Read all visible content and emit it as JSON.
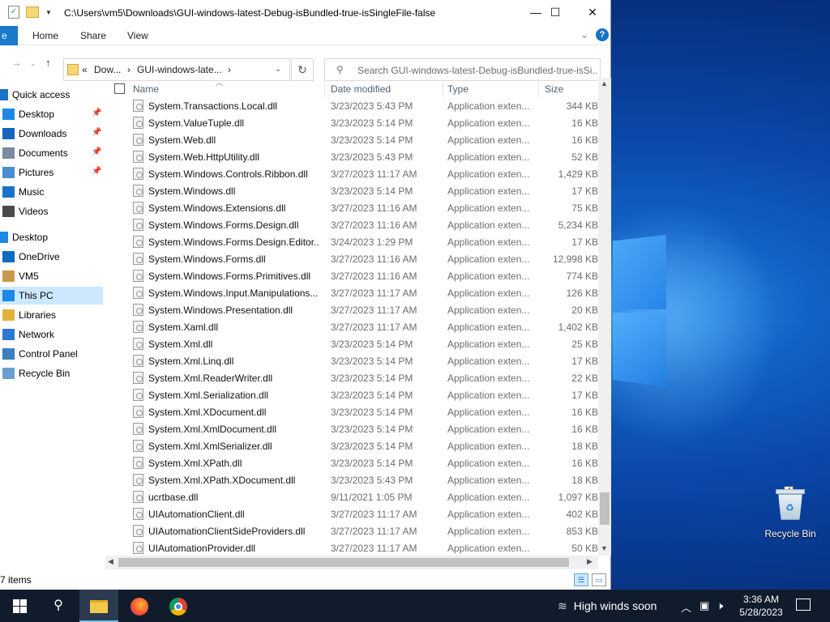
{
  "window": {
    "title": "C:\\Users\\vm5\\Downloads\\GUI-windows-latest-Debug-isBundled-true-isSingleFile-false",
    "minimize": "—",
    "maximize": "☐",
    "close": "✕"
  },
  "ribbon": {
    "file_tab": "e",
    "tabs": [
      "Home",
      "Share",
      "View"
    ]
  },
  "address": {
    "crumb_prefix": "«",
    "crumb1": "Dow...",
    "crumb2": "GUI-windows-late...",
    "sep": "›"
  },
  "search": {
    "placeholder": "Search GUI-windows-latest-Debug-isBundled-true-isSi..."
  },
  "nav": {
    "items": [
      {
        "label": "Quick access",
        "icon": "star-icon",
        "pinned": false
      },
      {
        "label": "Desktop",
        "icon": "desktop-icon",
        "pinned": true
      },
      {
        "label": "Downloads",
        "icon": "download-icon",
        "pinned": true
      },
      {
        "label": "Documents",
        "icon": "documents-icon",
        "pinned": true
      },
      {
        "label": "Pictures",
        "icon": "pictures-icon",
        "pinned": true
      },
      {
        "label": "Music",
        "icon": "music-icon",
        "pinned": false
      },
      {
        "label": "Videos",
        "icon": "videos-icon",
        "pinned": false
      },
      {
        "label": "Desktop",
        "icon": "desktop-icon",
        "pinned": false
      },
      {
        "label": "OneDrive",
        "icon": "cloud-icon",
        "pinned": false
      },
      {
        "label": "VM5",
        "icon": "user-icon",
        "pinned": false
      },
      {
        "label": "This PC",
        "icon": "computer-icon",
        "pinned": false
      },
      {
        "label": "Libraries",
        "icon": "library-icon",
        "pinned": false
      },
      {
        "label": "Network",
        "icon": "network-icon",
        "pinned": false
      },
      {
        "label": "Control Panel",
        "icon": "control-panel-icon",
        "pinned": false
      },
      {
        "label": "Recycle Bin",
        "icon": "recycle-bin-icon",
        "pinned": false
      }
    ],
    "selected": "This PC"
  },
  "columns": {
    "name": "Name",
    "date": "Date modified",
    "type": "Type",
    "size": "Size"
  },
  "files": [
    {
      "name": "System.Transactions.Local.dll",
      "date": "3/23/2023 5:43 PM",
      "type": "Application exten...",
      "size": "344 KB"
    },
    {
      "name": "System.ValueTuple.dll",
      "date": "3/23/2023 5:14 PM",
      "type": "Application exten...",
      "size": "16 KB"
    },
    {
      "name": "System.Web.dll",
      "date": "3/23/2023 5:14 PM",
      "type": "Application exten...",
      "size": "16 KB"
    },
    {
      "name": "System.Web.HttpUtility.dll",
      "date": "3/23/2023 5:43 PM",
      "type": "Application exten...",
      "size": "52 KB"
    },
    {
      "name": "System.Windows.Controls.Ribbon.dll",
      "date": "3/27/2023 11:17 AM",
      "type": "Application exten...",
      "size": "1,429 KB"
    },
    {
      "name": "System.Windows.dll",
      "date": "3/23/2023 5:14 PM",
      "type": "Application exten...",
      "size": "17 KB"
    },
    {
      "name": "System.Windows.Extensions.dll",
      "date": "3/27/2023 11:16 AM",
      "type": "Application exten...",
      "size": "75 KB"
    },
    {
      "name": "System.Windows.Forms.Design.dll",
      "date": "3/27/2023 11:16 AM",
      "type": "Application exten...",
      "size": "5,234 KB"
    },
    {
      "name": "System.Windows.Forms.Design.Editor...",
      "date": "3/24/2023 1:29 PM",
      "type": "Application exten...",
      "size": "17 KB"
    },
    {
      "name": "System.Windows.Forms.dll",
      "date": "3/27/2023 11:16 AM",
      "type": "Application exten...",
      "size": "12,998 KB"
    },
    {
      "name": "System.Windows.Forms.Primitives.dll",
      "date": "3/27/2023 11:16 AM",
      "type": "Application exten...",
      "size": "774 KB"
    },
    {
      "name": "System.Windows.Input.Manipulations...",
      "date": "3/27/2023 11:17 AM",
      "type": "Application exten...",
      "size": "126 KB"
    },
    {
      "name": "System.Windows.Presentation.dll",
      "date": "3/27/2023 11:17 AM",
      "type": "Application exten...",
      "size": "20 KB"
    },
    {
      "name": "System.Xaml.dll",
      "date": "3/27/2023 11:17 AM",
      "type": "Application exten...",
      "size": "1,402 KB"
    },
    {
      "name": "System.Xml.dll",
      "date": "3/23/2023 5:14 PM",
      "type": "Application exten...",
      "size": "25 KB"
    },
    {
      "name": "System.Xml.Linq.dll",
      "date": "3/23/2023 5:14 PM",
      "type": "Application exten...",
      "size": "17 KB"
    },
    {
      "name": "System.Xml.ReaderWriter.dll",
      "date": "3/23/2023 5:14 PM",
      "type": "Application exten...",
      "size": "22 KB"
    },
    {
      "name": "System.Xml.Serialization.dll",
      "date": "3/23/2023 5:14 PM",
      "type": "Application exten...",
      "size": "17 KB"
    },
    {
      "name": "System.Xml.XDocument.dll",
      "date": "3/23/2023 5:14 PM",
      "type": "Application exten...",
      "size": "16 KB"
    },
    {
      "name": "System.Xml.XmlDocument.dll",
      "date": "3/23/2023 5:14 PM",
      "type": "Application exten...",
      "size": "16 KB"
    },
    {
      "name": "System.Xml.XmlSerializer.dll",
      "date": "3/23/2023 5:14 PM",
      "type": "Application exten...",
      "size": "18 KB"
    },
    {
      "name": "System.Xml.XPath.dll",
      "date": "3/23/2023 5:14 PM",
      "type": "Application exten...",
      "size": "16 KB"
    },
    {
      "name": "System.Xml.XPath.XDocument.dll",
      "date": "3/23/2023 5:43 PM",
      "type": "Application exten...",
      "size": "18 KB"
    },
    {
      "name": "ucrtbase.dll",
      "date": "9/11/2021 1:05 PM",
      "type": "Application exten...",
      "size": "1,097 KB"
    },
    {
      "name": "UIAutomationClient.dll",
      "date": "3/27/2023 11:17 AM",
      "type": "Application exten...",
      "size": "402 KB"
    },
    {
      "name": "UIAutomationClientSideProviders.dll",
      "date": "3/27/2023 11:17 AM",
      "type": "Application exten...",
      "size": "853 KB"
    },
    {
      "name": "UIAutomationProvider.dll",
      "date": "3/27/2023 11:17 AM",
      "type": "Application exten...",
      "size": "50 KB"
    }
  ],
  "status": {
    "items_text": "7 items"
  },
  "desktop": {
    "recycle_bin_label": "Recycle Bin"
  },
  "taskbar": {
    "weather": "High winds soon",
    "time": "3:36 AM",
    "date": "5/28/2023"
  },
  "colors": {
    "accent": "#1979ca",
    "selection": "#cce8ff",
    "taskbar": "#101c2b",
    "desktop": "#0a46a8"
  }
}
